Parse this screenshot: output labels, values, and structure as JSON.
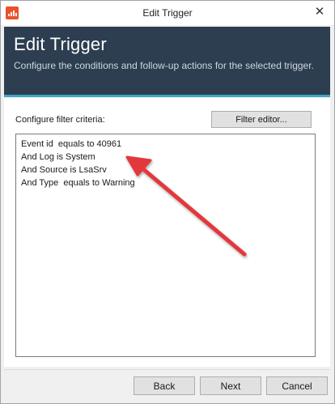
{
  "window": {
    "title": "Edit Trigger",
    "close_glyph": "✕"
  },
  "header": {
    "title": "Edit Trigger",
    "description": "Configure the conditions and follow-up actions for the selected trigger."
  },
  "filter": {
    "label": "Configure filter criteria:",
    "editor_button": "Filter editor...",
    "criteria": [
      "Event id  equals to 40961",
      "And Log is System",
      "And Source is LsaSrv",
      "And Type  equals to Warning"
    ]
  },
  "footer": {
    "back": "Back",
    "next": "Next",
    "cancel": "Cancel"
  },
  "colors": {
    "header_bg": "#2c3e50",
    "header_accent": "#3aa7c4",
    "arrow": "#e2393c",
    "app_icon": "#e8532c"
  },
  "icons": {
    "app": "app-logo-icon",
    "close": "close-icon",
    "annotation": "annotation-arrow-icon"
  }
}
